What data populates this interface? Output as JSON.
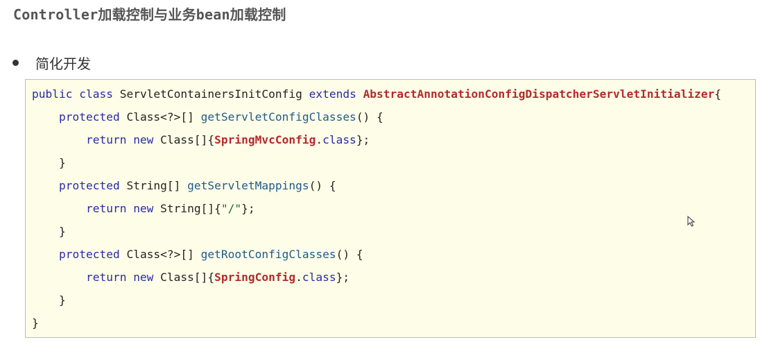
{
  "header": {
    "title": "Controller加载控制与业务bean加载控制"
  },
  "bullet": {
    "text": "简化开发"
  },
  "code": {
    "line1": {
      "kw1": "public class ",
      "name": "ServletContainersInitConfig ",
      "kw2": "extends ",
      "parent": "AbstractAnnotationConfigDispatcherServletInitializer",
      "brace": "{"
    },
    "line2": {
      "kw": "protected ",
      "type": "Class<?>[] ",
      "method": "getServletConfigClasses",
      "rest": "() {"
    },
    "line3": {
      "kw": "return new ",
      "type": "Class[]{",
      "cls": "SpringMvcConfig",
      "dot": ".",
      "clskw": "class",
      "end": "};"
    },
    "line4": {
      "text": "}"
    },
    "line5": {
      "kw": "protected ",
      "type": "String[] ",
      "method": "getServletMappings",
      "rest": "() {"
    },
    "line6": {
      "kw": "return new ",
      "type": "String[]{",
      "str": "\"/\"",
      "end": "};"
    },
    "line7": {
      "text": "}"
    },
    "line8": {
      "kw": "protected ",
      "type": "Class<?>[] ",
      "method": "getRootConfigClasses",
      "rest": "() {"
    },
    "line9": {
      "kw": "return new ",
      "type": "Class[]{",
      "cls": "SpringConfig",
      "dot": ".",
      "clskw": "class",
      "end": "};"
    },
    "line10": {
      "text": "}"
    },
    "line11": {
      "text": "}"
    }
  }
}
